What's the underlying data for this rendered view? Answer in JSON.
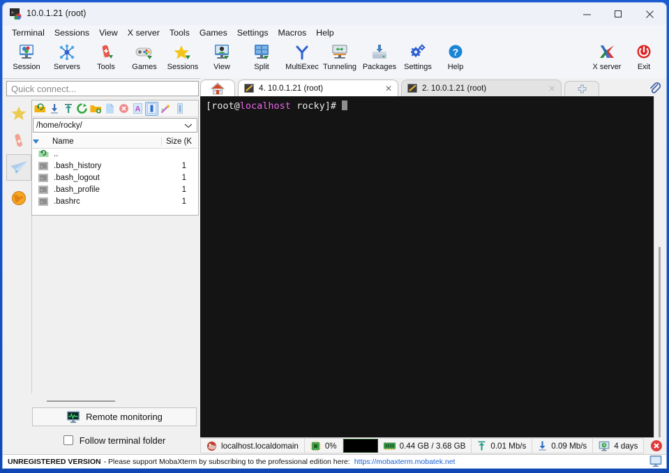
{
  "window": {
    "title": "10.0.1.21 (root)",
    "icon": "mobaxterm-icon",
    "minimize_label": "—",
    "maximize_label": "□",
    "close_label": "✕"
  },
  "menubar": {
    "items": [
      {
        "label": "Terminal",
        "name": "menu-terminal"
      },
      {
        "label": "Sessions",
        "name": "menu-sessions"
      },
      {
        "label": "View",
        "name": "menu-view"
      },
      {
        "label": "X server",
        "name": "menu-x-server"
      },
      {
        "label": "Tools",
        "name": "menu-tools"
      },
      {
        "label": "Games",
        "name": "menu-games"
      },
      {
        "label": "Settings",
        "name": "menu-settings"
      },
      {
        "label": "Macros",
        "name": "menu-macros"
      },
      {
        "label": "Help",
        "name": "menu-help"
      }
    ]
  },
  "toolbar": {
    "items": [
      {
        "label": "Session",
        "icon": "session-icon",
        "name": "toolbar-session"
      },
      {
        "label": "Servers",
        "icon": "servers-icon",
        "name": "toolbar-servers"
      },
      {
        "label": "Tools",
        "icon": "tools-icon",
        "name": "toolbar-tools"
      },
      {
        "label": "Games",
        "icon": "games-icon",
        "name": "toolbar-games"
      },
      {
        "label": "Sessions",
        "icon": "sessions-star-icon",
        "name": "toolbar-sessions"
      },
      {
        "label": "View",
        "icon": "view-icon",
        "name": "toolbar-view"
      },
      {
        "label": "Split",
        "icon": "split-icon",
        "name": "toolbar-split"
      },
      {
        "label": "MultiExec",
        "icon": "multiexec-icon",
        "name": "toolbar-multiexec"
      },
      {
        "label": "Tunneling",
        "icon": "tunneling-icon",
        "name": "toolbar-tunneling"
      },
      {
        "label": "Packages",
        "icon": "packages-icon",
        "name": "toolbar-packages"
      },
      {
        "label": "Settings",
        "icon": "settings-gear-icon",
        "name": "toolbar-settings"
      },
      {
        "label": "Help",
        "icon": "help-icon",
        "name": "toolbar-help"
      }
    ],
    "right_items": [
      {
        "label": "X server",
        "icon": "x-server-icon",
        "name": "toolbar-x-server"
      },
      {
        "label": "Exit",
        "icon": "power-icon",
        "name": "toolbar-exit"
      }
    ]
  },
  "quick_connect": {
    "placeholder": "Quick connect...",
    "value": ""
  },
  "sidebar": {
    "items": [
      {
        "icon": "star-icon",
        "name": "sidebar-bookmarks",
        "selected": false
      },
      {
        "icon": "swiss-knife-icon",
        "name": "sidebar-tools",
        "selected": false
      },
      {
        "icon": "paper-plane-icon",
        "name": "sidebar-sftp",
        "selected": true
      },
      {
        "icon": "globe-icon",
        "name": "sidebar-macros",
        "selected": false
      }
    ]
  },
  "sftp": {
    "toolbar_buttons": [
      {
        "icon": "parent-folder-icon",
        "name": "sftp-parent-folder",
        "active": false
      },
      {
        "icon": "download-icon",
        "name": "sftp-download",
        "active": false
      },
      {
        "icon": "upload-icon",
        "name": "sftp-upload",
        "active": false
      },
      {
        "icon": "refresh-icon",
        "name": "sftp-refresh",
        "active": false
      },
      {
        "icon": "new-folder-icon",
        "name": "sftp-new-folder",
        "active": false
      },
      {
        "icon": "new-file-icon",
        "name": "sftp-new-file",
        "active": false
      },
      {
        "icon": "delete-icon",
        "name": "sftp-delete",
        "active": false
      },
      {
        "icon": "text-mode-icon",
        "name": "sftp-text-mode",
        "active": false
      },
      {
        "icon": "show-hidden-icon",
        "name": "sftp-show-hidden",
        "active": true
      },
      {
        "icon": "magic-wand-icon",
        "name": "sftp-magic-wand",
        "active": false
      },
      {
        "icon": "extra-icon",
        "name": "sftp-extra",
        "active": false
      }
    ],
    "path": "/home/rocky/",
    "columns": {
      "name": "Name",
      "size": "Size (K"
    },
    "rows": [
      {
        "name": "..",
        "size": "",
        "icon": "parent-folder-icon"
      },
      {
        "name": ".bash_history",
        "size": "1",
        "icon": "file-icon"
      },
      {
        "name": ".bash_logout",
        "size": "1",
        "icon": "file-icon"
      },
      {
        "name": ".bash_profile",
        "size": "1",
        "icon": "file-icon"
      },
      {
        "name": ".bashrc",
        "size": "1",
        "icon": "file-icon"
      }
    ]
  },
  "lower_panel": {
    "remote_monitoring_label": "Remote monitoring",
    "remote_monitoring_icon": "monitor-graph-icon",
    "follow_terminal_label": "Follow terminal folder",
    "follow_terminal_checked": false
  },
  "tabs": {
    "home_icon": "home-icon",
    "items": [
      {
        "label": "4. 10.0.1.21 (root)",
        "icon": "terminal-tab-icon",
        "active": true,
        "close": "✕",
        "name": "tab-session-4"
      },
      {
        "label": "2. 10.0.1.21 (root)",
        "icon": "terminal-tab-icon",
        "active": false,
        "close": "✕",
        "name": "tab-session-2"
      }
    ],
    "add_label": "+",
    "clip_icon": "paperclip-icon"
  },
  "terminal": {
    "prompt_prefix": "[root@",
    "prompt_host": "localhost",
    "prompt_suffix": " rocky]# ",
    "colors": {
      "host": "#e967e9",
      "text": "#e8e8e8",
      "background": "#141414",
      "cursor": "#8f8f8f"
    }
  },
  "statusbar": {
    "items": [
      {
        "label": "localhost.localdomain",
        "icon": "rocky-linux-icon",
        "name": "status-hostname"
      },
      {
        "label": "0%",
        "icon": "cpu-icon",
        "name": "status-cpu"
      },
      {
        "label": "",
        "icon": "cpu-graph",
        "name": "status-cpu-graph"
      },
      {
        "label": "0.44 GB / 3.68 GB",
        "icon": "ram-icon",
        "name": "status-memory"
      },
      {
        "label": "0.01 Mb/s",
        "icon": "upload-arrow-icon",
        "name": "status-upload"
      },
      {
        "label": "0.09 Mb/s",
        "icon": "download-arrow-icon",
        "name": "status-download"
      },
      {
        "label": "4 days",
        "icon": "uptime-icon",
        "name": "status-uptime"
      }
    ],
    "close_icon": "close-circle-icon"
  },
  "footer": {
    "strong": "UNREGISTERED VERSION",
    "text": "-  Please support MobaXterm by subscribing to the professional edition here:",
    "link": "https://mobaxterm.mobatek.net",
    "monitor_icon": "monitor-icon"
  }
}
